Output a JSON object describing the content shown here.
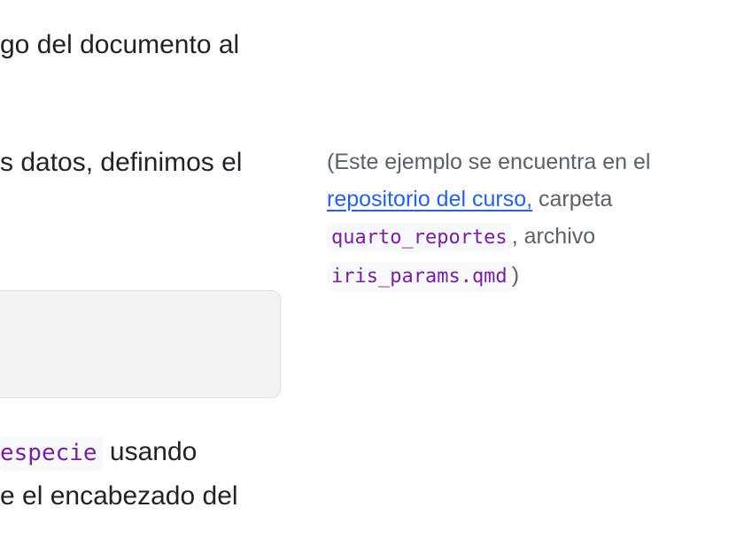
{
  "main": {
    "line1": "go del documento al",
    "line2": "s datos, definimos el",
    "line3_code": "especie",
    "line3_text": " usando",
    "line4": "e el encabezado del"
  },
  "margin_note": {
    "open_paren": "(Este ejemplo se encuentra en el ",
    "link_text": "repositorio del curso,",
    "after_link": " carpeta ",
    "code1": "quarto_reportes",
    "after_code1": ", archivo ",
    "code2": "iris_params.qmd",
    "close_paren": ")"
  }
}
